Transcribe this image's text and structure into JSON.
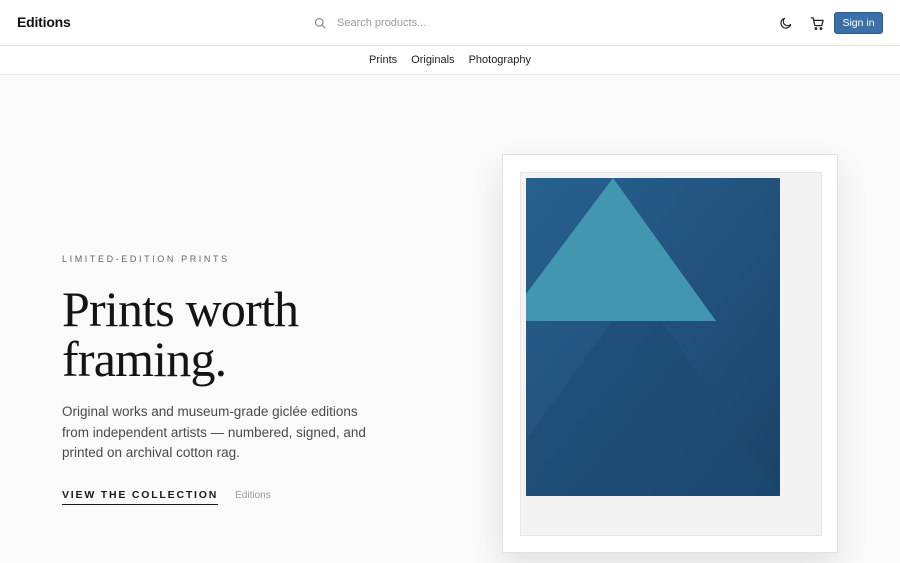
{
  "header": {
    "brand": "Editions",
    "search_placeholder": "Search products...",
    "signin_label": "Sign in"
  },
  "nav": {
    "items": [
      {
        "label": "Prints"
      },
      {
        "label": "Originals"
      },
      {
        "label": "Photography"
      }
    ]
  },
  "hero": {
    "eyebrow": "LIMITED-EDITION PRINTS",
    "headline_line1": "Prints worth",
    "headline_line2": "framing.",
    "subcopy": "Original works and museum-grade giclée editions from independent artists — numbered, signed, and printed on archival cotton rag.",
    "cta_label": "VIEW THE COLLECTION",
    "cta_secondary": "Editions"
  },
  "colors": {
    "accent": "#3b6fa8",
    "art_base": "#1f4e7a",
    "art_triangle": "#4296b0"
  },
  "icons": {
    "search": "search-icon",
    "theme": "moon-icon",
    "cart": "cart-icon"
  }
}
